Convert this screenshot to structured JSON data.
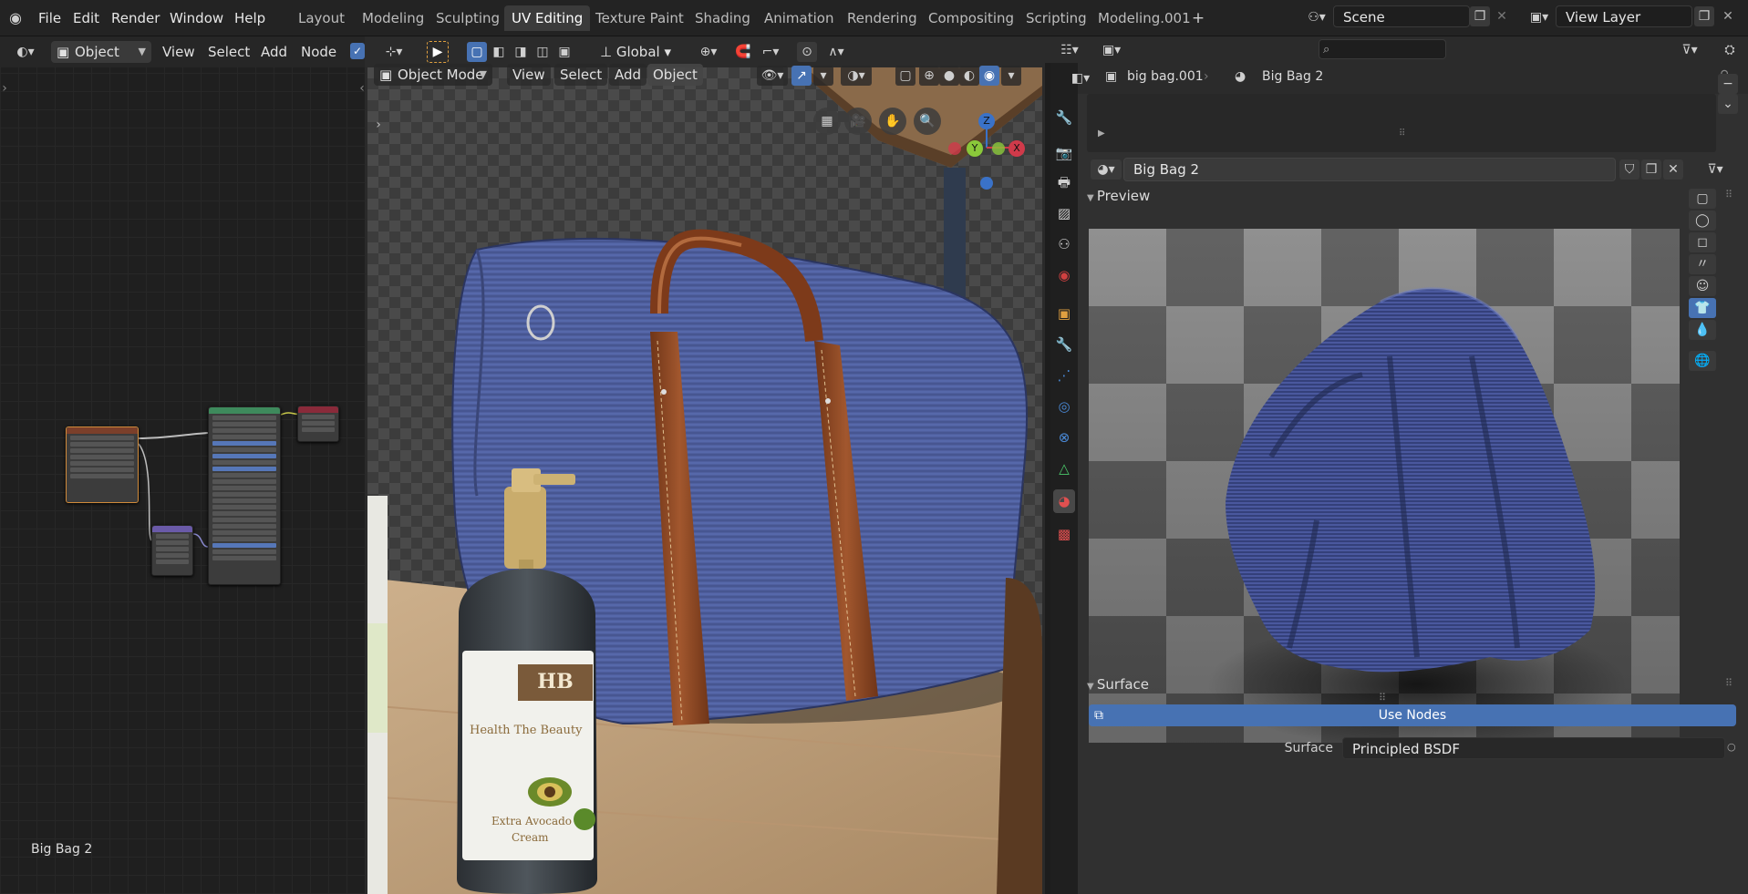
{
  "menu": {
    "file": "File",
    "edit": "Edit",
    "render": "Render",
    "window": "Window",
    "help": "Help"
  },
  "workspaces": [
    "Layout",
    "Modeling",
    "Sculpting",
    "UV Editing",
    "Texture Paint",
    "Shading",
    "Animation",
    "Rendering",
    "Compositing",
    "Scripting",
    "Modeling.001"
  ],
  "active_workspace": "UV Editing",
  "scene": {
    "name": "Scene",
    "view_layer": "View Layer"
  },
  "node_editor": {
    "object_label": "Object",
    "menu": {
      "view": "View",
      "select": "Select",
      "add": "Add",
      "node": "Node"
    },
    "material_name_overlay": "Big Bag 2"
  },
  "viewport": {
    "mode": "Object Mode",
    "menu": {
      "view": "View",
      "select": "Select",
      "add": "Add",
      "object": "Object"
    },
    "transform_orientation": "Global",
    "gizmo": {
      "z": "Z",
      "y": "Y",
      "x": "X"
    },
    "bottle_brand": "HB",
    "bottle_line1": "Health The Beauty",
    "bottle_line2": "Extra Avocado",
    "bottle_line3": "Cream"
  },
  "properties": {
    "object_name": "big bag.001",
    "material_name": "Big Bag 2",
    "material_field": "Big Bag 2",
    "preview_label": "Preview",
    "surface_label": "Surface",
    "use_nodes_label": "Use Nodes",
    "surface_field_label": "Surface",
    "surface_value": "Principled BSDF"
  },
  "colors": {
    "accent": "#4772b3",
    "header": "#2b2b2b",
    "panel": "#303030",
    "bag": "#4a5a96",
    "strap": "#8b4a2a"
  }
}
